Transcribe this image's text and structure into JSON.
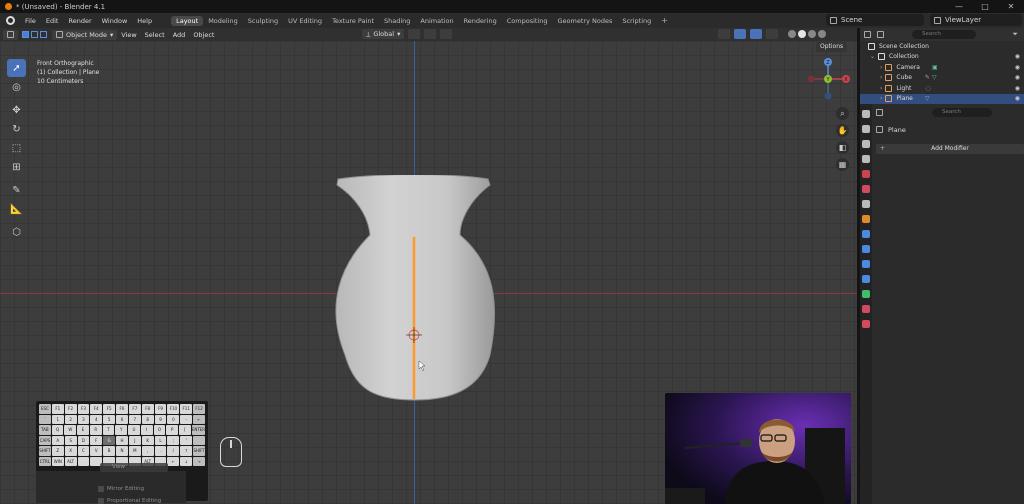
{
  "window": {
    "title": "* (Unsaved) - Blender 4.1",
    "controls": [
      "—",
      "□",
      "✕"
    ]
  },
  "menu": {
    "items": [
      "File",
      "Edit",
      "Render",
      "Window",
      "Help"
    ]
  },
  "workspaces": {
    "tabs": [
      "Layout",
      "Modeling",
      "Sculpting",
      "UV Editing",
      "Texture Paint",
      "Shading",
      "Animation",
      "Rendering",
      "Compositing",
      "Geometry Nodes",
      "Scripting"
    ],
    "active": "Layout",
    "plus": "+"
  },
  "scene": {
    "label": "Scene"
  },
  "view_layer": {
    "label": "ViewLayer"
  },
  "viewport_header": {
    "mode": "Object Mode",
    "menus": [
      "View",
      "Select",
      "Add",
      "Object"
    ],
    "orientation": "Global"
  },
  "viewport": {
    "info": {
      "line1": "Front Orthographic",
      "line2": "(1) Collection | Plane",
      "line3": "10 Centimeters"
    },
    "options_label": "Options",
    "gizmo": {
      "z": "Z",
      "y": "Y",
      "x": "X"
    }
  },
  "screencast_keys": {
    "rows": [
      [
        "ESC",
        "F1",
        "F2",
        "F3",
        "F4",
        "F5",
        "F6",
        "F7",
        "F8",
        "F9",
        "F10",
        "F11",
        "F12"
      ],
      [
        "`",
        "1",
        "2",
        "3",
        "4",
        "5",
        "6",
        "7",
        "8",
        "9",
        "0",
        "-",
        "←"
      ],
      [
        "TAB",
        "Q",
        "W",
        "E",
        "R",
        "T",
        "Y",
        "U",
        "I",
        "O",
        "P",
        "[",
        "ENTER"
      ],
      [
        "CAPS",
        "A",
        "S",
        "D",
        "F",
        "G",
        "H",
        "J",
        "K",
        "L",
        ";",
        "'",
        ""
      ],
      [
        "SHIFT",
        "Z",
        "X",
        "C",
        "V",
        "B",
        "N",
        "M",
        ",",
        ".",
        "/",
        "↑",
        "SHIFT"
      ],
      [
        "CTRL",
        "WIN",
        "ALT",
        "",
        "",
        "",
        "",
        "",
        "ALT",
        "",
        "←",
        "↓",
        "→"
      ]
    ],
    "pressed": "G",
    "popup": "View",
    "ops": {
      "mirror": "Mirror Editing",
      "proportional": "Proportional Editing"
    }
  },
  "outliner": {
    "search_placeholder": "Search",
    "scene_collection": "Scene Collection",
    "collection": "Collection",
    "items": [
      {
        "name": "Camera",
        "icon_color": "#e0a060"
      },
      {
        "name": "Cube",
        "icon_color": "#e0a060"
      },
      {
        "name": "Light",
        "icon_color": "#e0a060"
      },
      {
        "name": "Plane",
        "icon_color": "#e0a060",
        "selected": true
      }
    ]
  },
  "properties": {
    "search_placeholder": "Search",
    "object_name": "Plane",
    "add_modifier": "Add Modifier"
  },
  "colors": {
    "accent": "#4a72b8",
    "x_axis": "#8a3a3e",
    "z_axis": "#3b5f9a",
    "edge_highlight": "#ff9a2a"
  }
}
